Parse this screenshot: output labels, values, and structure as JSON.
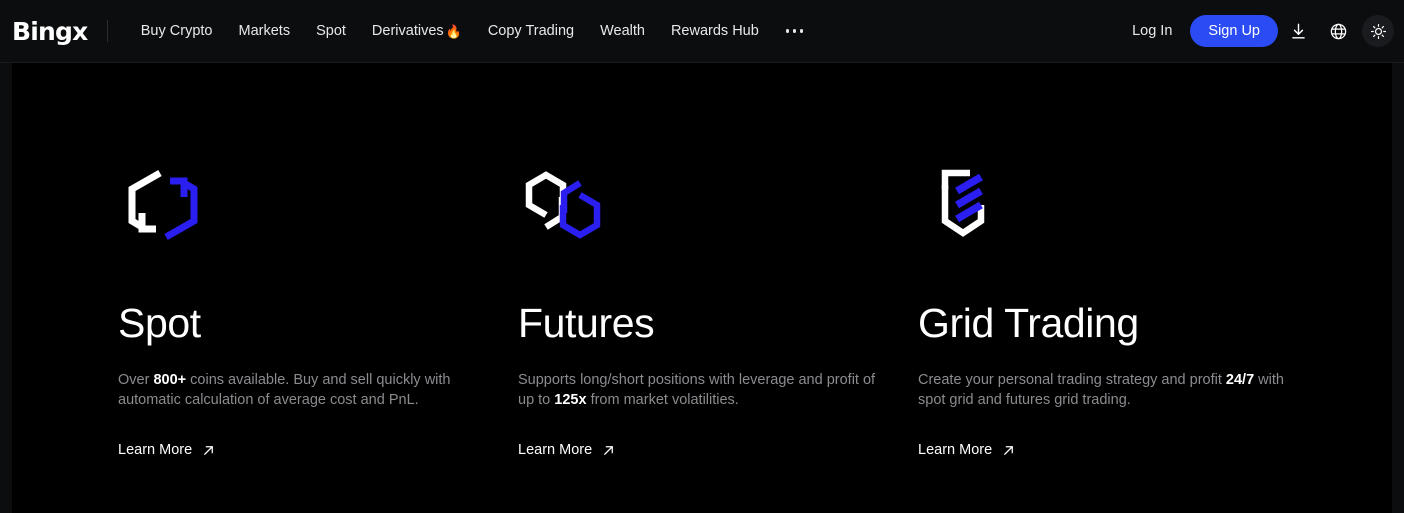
{
  "header": {
    "logo_text": "Bing",
    "logo_mark": "x",
    "nav_items": [
      {
        "label": "Buy Crypto",
        "icon": null
      },
      {
        "label": "Markets",
        "icon": null
      },
      {
        "label": "Spot",
        "icon": null
      },
      {
        "label": "Derivatives",
        "icon": "fire-emoji",
        "emoji": "🔥"
      },
      {
        "label": "Copy Trading",
        "icon": null
      },
      {
        "label": "Wealth",
        "icon": null
      },
      {
        "label": "Rewards Hub",
        "icon": null
      }
    ],
    "more_menu": "more-horizontal-icon",
    "login_label": "Log In",
    "signup_label": "Sign Up",
    "download_icon": "download-icon",
    "language_icon": "globe-icon",
    "theme_icon": "sun-brightness-icon",
    "accent_color": "#2b4cf5"
  },
  "main": {
    "cards": [
      {
        "id": "spot",
        "icon_name": "spot-exchange-arrows-icon",
        "title": "Spot",
        "desc_parts": [
          {
            "text": "Over ",
            "bold": false
          },
          {
            "text": "800+",
            "bold": true
          },
          {
            "text": " coins available. Buy and sell quickly with automatic calculation of average cost and PnL.",
            "bold": false
          }
        ],
        "link_label": "Learn More",
        "link_icon": "arrow-up-right-icon"
      },
      {
        "id": "futures",
        "icon_name": "futures-interlocking-hexagons-icon",
        "title": "Futures",
        "desc_parts": [
          {
            "text": "Supports long/short positions with leverage and profit of up to ",
            "bold": false
          },
          {
            "text": "125x",
            "bold": true
          },
          {
            "text": " from market volatilities.",
            "bold": false
          }
        ],
        "link_label": "Learn More",
        "link_icon": "arrow-up-right-icon"
      },
      {
        "id": "grid",
        "icon_name": "grid-trading-hexagon-bars-icon",
        "title": "Grid Trading",
        "desc_parts": [
          {
            "text": "Create your personal trading strategy and profit ",
            "bold": false
          },
          {
            "text": "24/7",
            "bold": true
          },
          {
            "text": " with spot grid and futures grid trading.",
            "bold": false
          }
        ],
        "link_label": "Learn More",
        "link_icon": "arrow-up-right-icon"
      }
    ]
  },
  "colors": {
    "page_bg": "#0c0d0f",
    "stage_bg": "#000000",
    "text_primary": "#ffffff",
    "text_muted": "#8b8b90",
    "accent_blue": "#2b4cf5",
    "icon_blue": "#2a1ef0"
  }
}
